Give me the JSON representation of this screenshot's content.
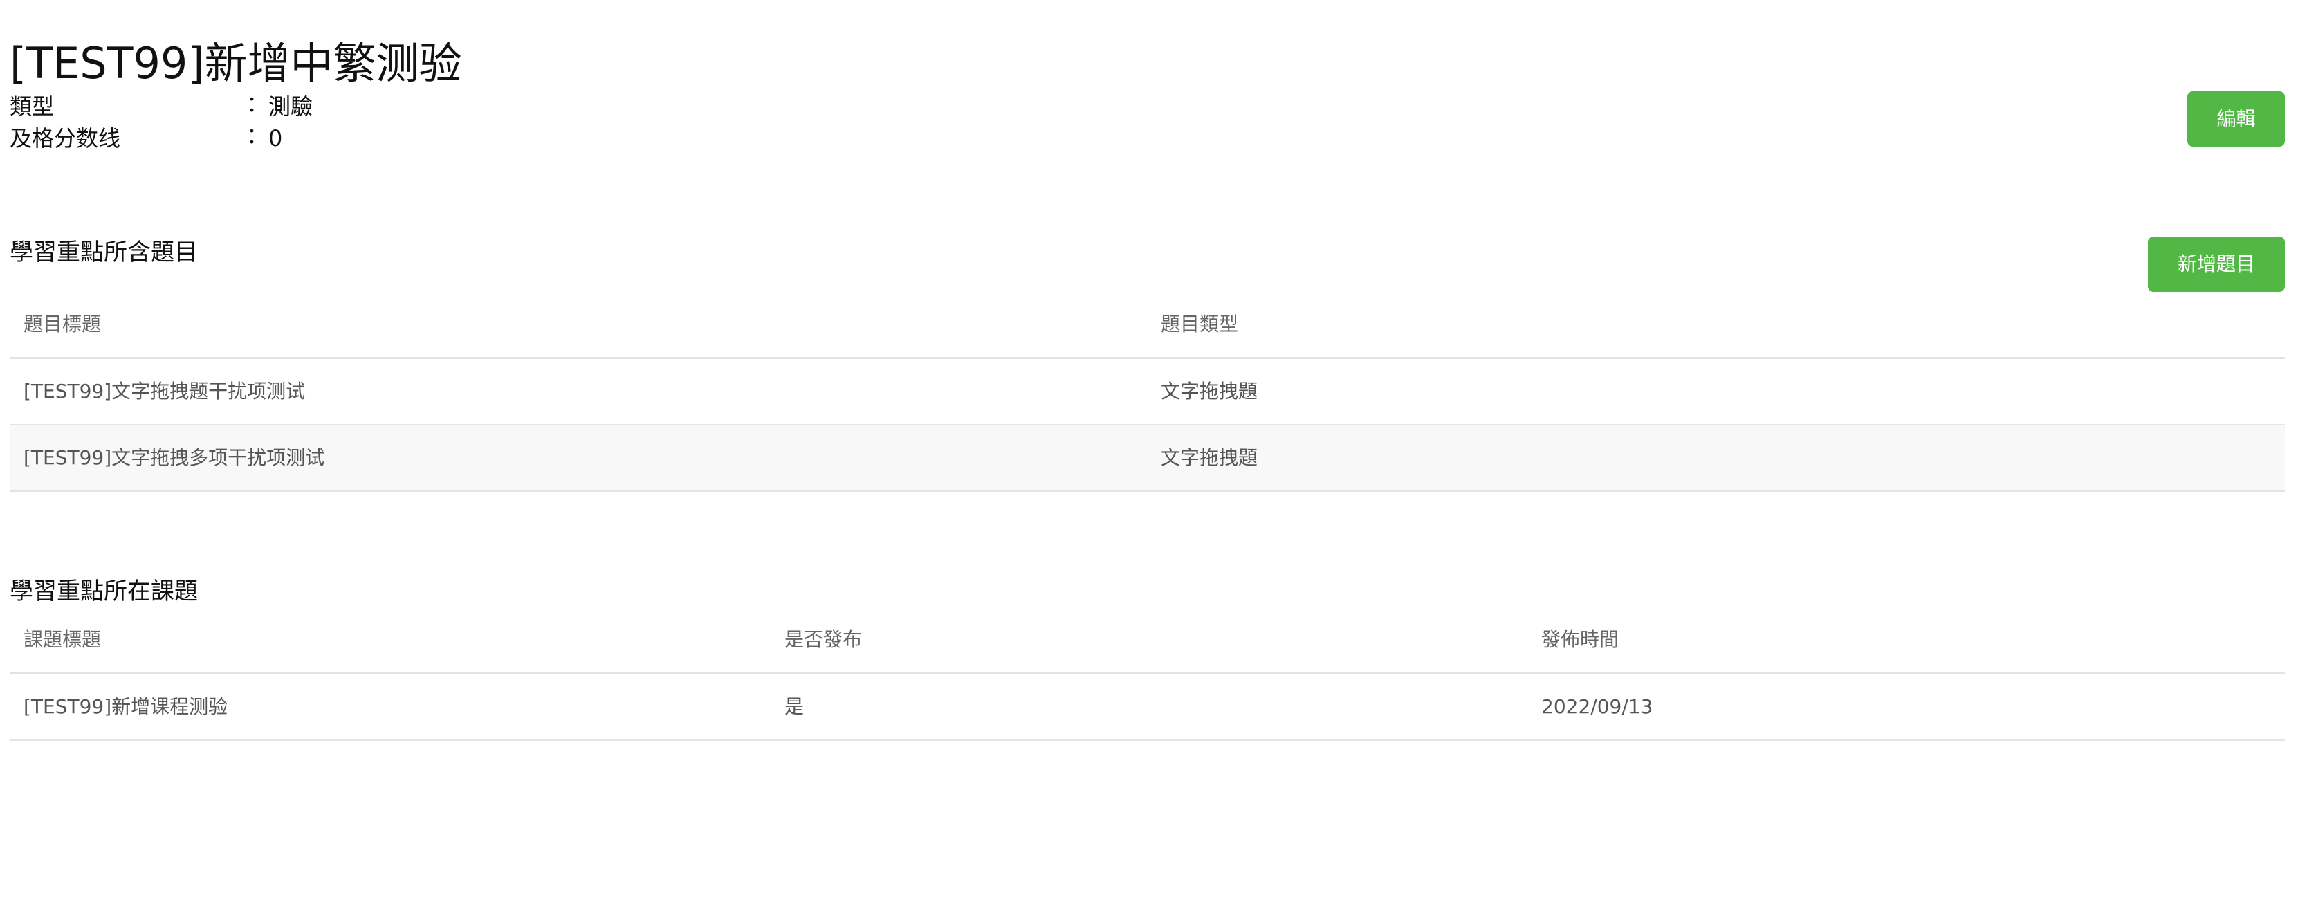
{
  "header": {
    "title": "[TEST99]新增中繁测验",
    "edit_label": "編輯"
  },
  "meta": [
    {
      "label": "類型",
      "colon": "：",
      "value": "測驗"
    },
    {
      "label": "及格分数线",
      "colon": "：",
      "value": "0"
    }
  ],
  "questions_section": {
    "title": "學習重點所含題目",
    "add_label": "新增題目",
    "columns": [
      "題目標題",
      "題目類型"
    ],
    "rows": [
      [
        "[TEST99]文字拖拽题干扰项测试",
        "文字拖拽題"
      ],
      [
        "[TEST99]文字拖拽多项干扰项测试",
        "文字拖拽題"
      ]
    ]
  },
  "lessons_section": {
    "title": "學習重點所在課題",
    "columns": [
      "課題標題",
      "是否發布",
      "發佈時間"
    ],
    "rows": [
      [
        "[TEST99]新增课程测验",
        "是",
        "2022/09/13"
      ]
    ]
  },
  "colors": {
    "accent": "#52b745",
    "row_alt": "#f8f8f8",
    "divider": "#e4e4e4"
  }
}
